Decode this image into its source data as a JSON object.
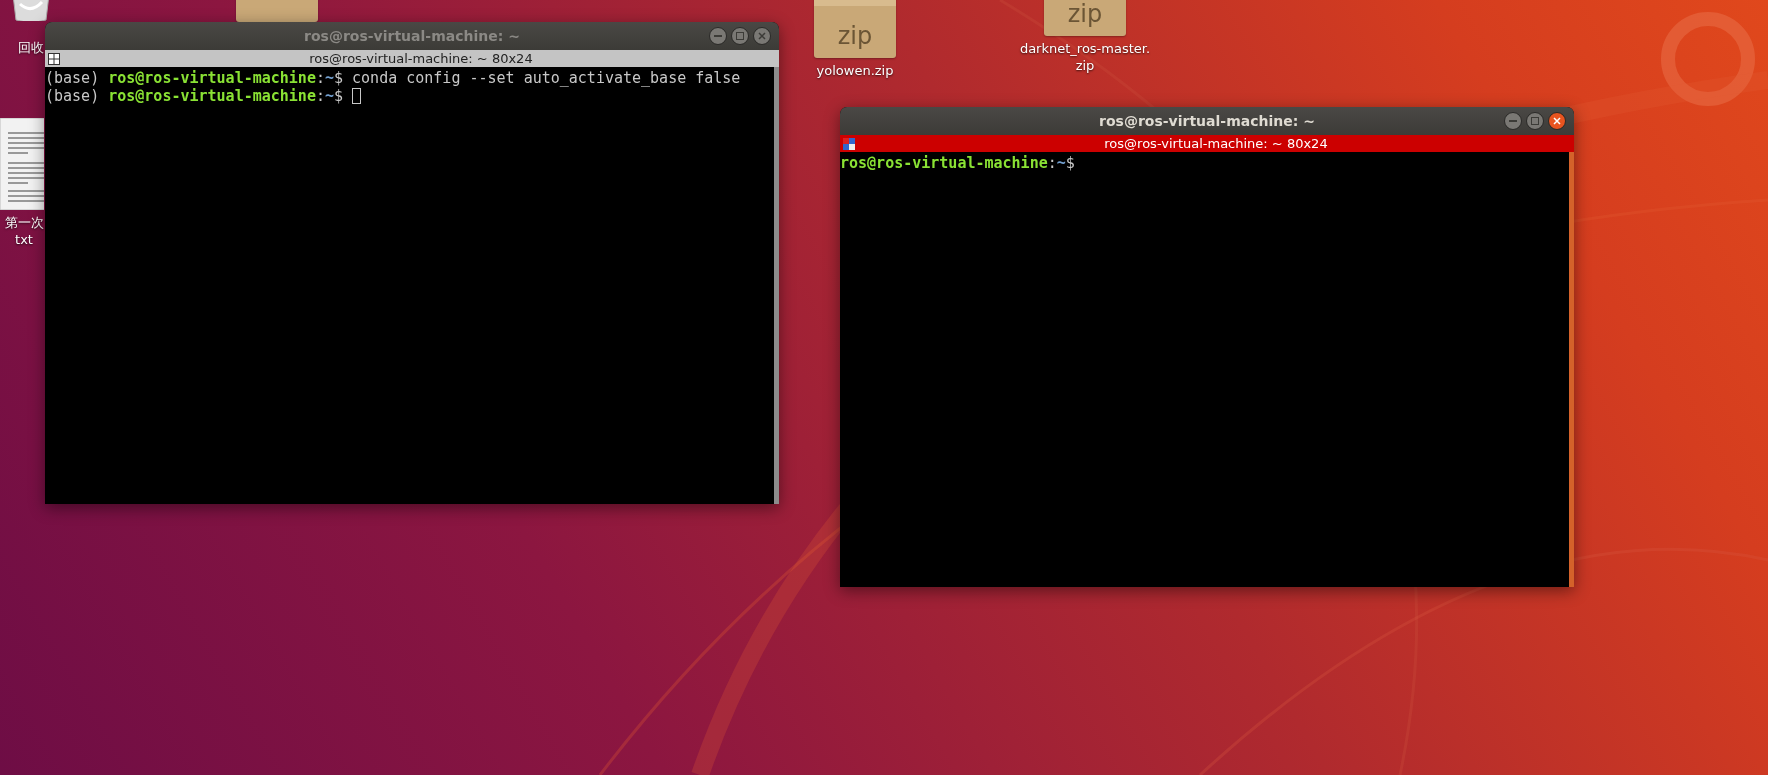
{
  "desktop_icons": [
    {
      "kind": "trash",
      "label_lines": [
        "回收"
      ]
    },
    {
      "kind": "document",
      "label_lines": [
        "第一次",
        "txt"
      ]
    },
    {
      "kind": "zip"
    },
    {
      "kind": "zip",
      "icon_text": "zip",
      "label_lines": [
        "yolowen.zip"
      ]
    },
    {
      "kind": "zip",
      "icon_text": "zip",
      "label_lines": [
        "darknet_ros-master.",
        "zip"
      ]
    }
  ],
  "windows": [
    {
      "title": "ros@ros-virtual-machine: ~",
      "active": false,
      "tab_title": "ros@ros-virtual-machine: ~ 80x24",
      "lines": [
        {
          "cursor": false,
          "segments": [
            {
              "kind": "plain",
              "text": "(base) "
            },
            {
              "kind": "user",
              "text": "ros@ros-virtual-machine"
            },
            {
              "kind": "plain",
              "text": ":"
            },
            {
              "kind": "path",
              "text": "~"
            },
            {
              "kind": "plain",
              "text": "$ conda config --set auto_activate_base false"
            }
          ]
        },
        {
          "cursor": true,
          "segments": [
            {
              "kind": "plain",
              "text": "(base) "
            },
            {
              "kind": "user",
              "text": "ros@ros-virtual-machine"
            },
            {
              "kind": "plain",
              "text": ":"
            },
            {
              "kind": "path",
              "text": "~"
            },
            {
              "kind": "plain",
              "text": "$ "
            }
          ]
        }
      ]
    },
    {
      "title": "ros@ros-virtual-machine: ~",
      "active": true,
      "tab_title": "ros@ros-virtual-machine: ~ 80x24",
      "lines": [
        {
          "cursor": false,
          "segments": [
            {
              "kind": "user",
              "text": "ros@ros-virtual-machine"
            },
            {
              "kind": "plain",
              "text": ":"
            },
            {
              "kind": "path",
              "text": "~"
            },
            {
              "kind": "plain",
              "text": "$"
            }
          ]
        }
      ]
    }
  ]
}
